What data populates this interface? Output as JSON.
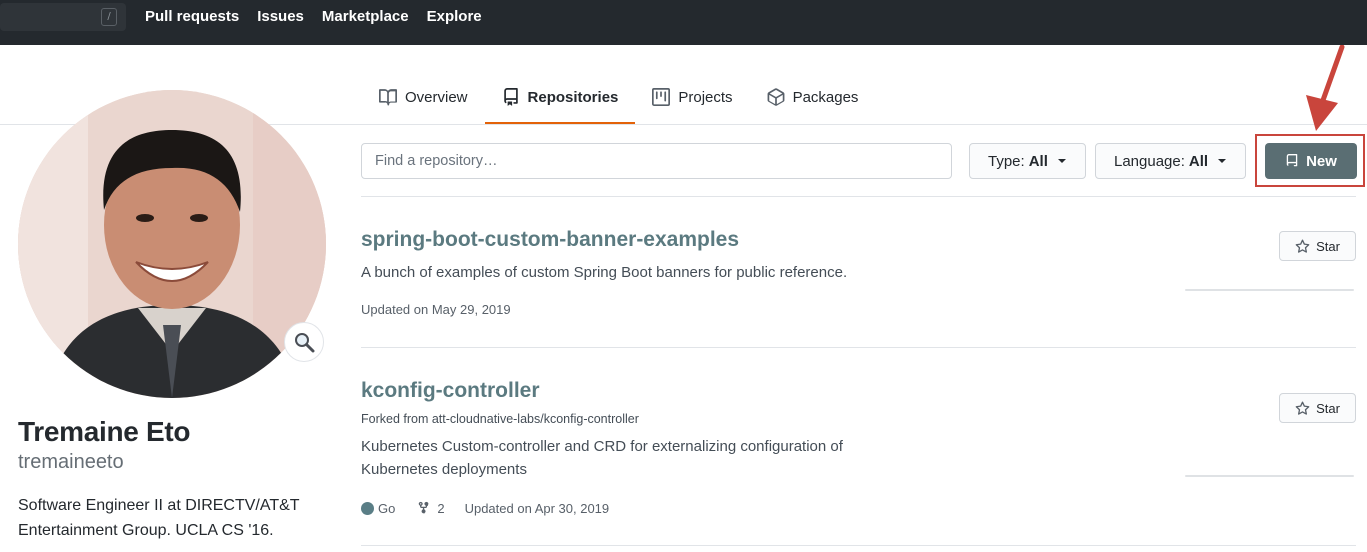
{
  "topnav": {
    "slash_key": "/",
    "items": [
      "Pull requests",
      "Issues",
      "Marketplace",
      "Explore"
    ]
  },
  "tabs": [
    {
      "label": "Overview",
      "icon": "book-icon",
      "selected": false
    },
    {
      "label": "Repositories",
      "icon": "repo-icon",
      "selected": true
    },
    {
      "label": "Projects",
      "icon": "project-icon",
      "selected": false
    },
    {
      "label": "Packages",
      "icon": "package-icon",
      "selected": false
    }
  ],
  "profile": {
    "full_name": "Tremaine Eto",
    "username": "tremaineeto",
    "bio": "Software Engineer II at DIRECTV/AT&T Entertainment Group. UCLA CS '16."
  },
  "filters": {
    "search_placeholder": "Find a repository…",
    "type_label": "Type:",
    "type_value": "All",
    "language_label": "Language:",
    "language_value": "All",
    "new_label": "New"
  },
  "repos": [
    {
      "name": "spring-boot-custom-banner-examples",
      "description": "A bunch of examples of custom Spring Boot banners for public reference.",
      "updated": "Updated on May 29, 2019",
      "star_label": "Star"
    },
    {
      "name": "kconfig-controller",
      "forked_from": "Forked from att-cloudnative-labs/kconfig-controller",
      "description": "Kubernetes Custom-controller and CRD for externalizing configuration of Kubernetes deployments",
      "language": "Go",
      "forks": "2",
      "updated": "Updated on Apr 30, 2019",
      "star_label": "Star"
    }
  ],
  "colors": {
    "topbar": "#24292e",
    "accent_tab_underline": "#e36209",
    "new_button": "#5a6e73",
    "highlight_red": "#c9453c",
    "repo_link": "#5b7a80",
    "go_language_dot": "#5a7e86"
  }
}
